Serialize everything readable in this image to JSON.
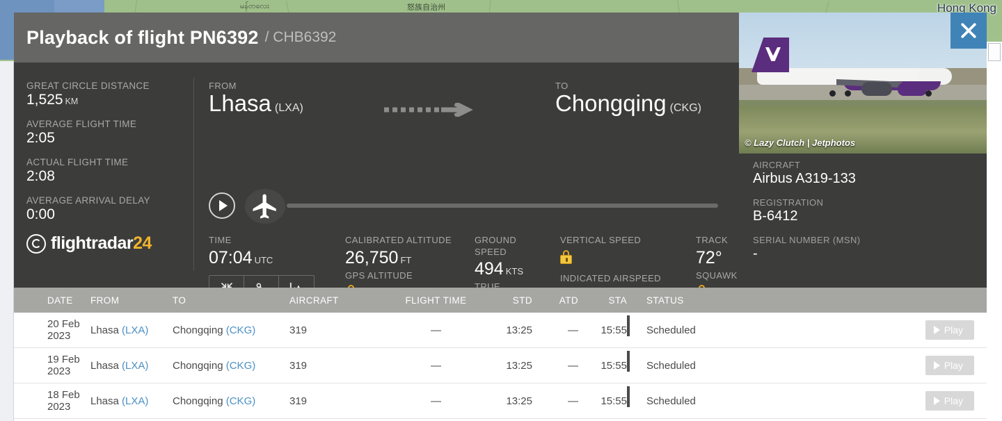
{
  "map": {
    "hong_kong_label": "Hong Kong",
    "labels": [
      "မန်တလေး",
      "怒族自治州"
    ]
  },
  "header": {
    "title": "Playback of flight PN6392",
    "subtitle": "/ CHB6392",
    "close_icon": "close-icon"
  },
  "stats": [
    {
      "label": "GREAT CIRCLE DISTANCE",
      "value": "1,525",
      "unit": "KM"
    },
    {
      "label": "AVERAGE FLIGHT TIME",
      "value": "2:05",
      "unit": ""
    },
    {
      "label": "ACTUAL FLIGHT TIME",
      "value": "2:08",
      "unit": ""
    },
    {
      "label": "AVERAGE ARRIVAL DELAY",
      "value": "0:00",
      "unit": ""
    }
  ],
  "logo": {
    "main": "flightradar",
    "accent": "24",
    "accent_color": "#f0b32d"
  },
  "route": {
    "from_label": "FROM",
    "from_city": "Lhasa",
    "from_code": "(LXA)",
    "to_label": "TO",
    "to_city": "Chongqing",
    "to_code": "(CKG)",
    "arrow_icon": "arrow-right-icon"
  },
  "playback": {
    "play_icon": "play-icon",
    "plane_icon": "airplane-handle-icon",
    "progress_percent": 0
  },
  "telemetry": {
    "time_label": "TIME",
    "time_value": "07:04",
    "time_unit": "UTC",
    "calibrated_altitude_label": "CALIBRATED ALTITUDE",
    "calibrated_altitude_value": "26,750",
    "calibrated_altitude_unit": "FT",
    "gps_altitude_label": "GPS ALTITUDE",
    "ground_speed_label": "GROUND SPEED",
    "ground_speed_value": "494",
    "ground_speed_unit": "KTS",
    "true_airspeed_label": "TRUE AIRSPEED",
    "vertical_speed_label": "VERTICAL SPEED",
    "indicated_airspeed_label": "INDICATED AIRSPEED",
    "track_label": "TRACK",
    "track_value": "72°",
    "squawk_label": "SQUAWK",
    "lock_icon": "lock-icon"
  },
  "icon_buttons": [
    {
      "name": "fit-to-screen-icon"
    },
    {
      "name": "flight-route-icon"
    },
    {
      "name": "altitude-graph-icon"
    }
  ],
  "photo": {
    "credit": "© Lazy Clutch | Jetphotos"
  },
  "aircraft_info": [
    {
      "label": "AIRCRAFT",
      "value": "Airbus A319-133"
    },
    {
      "label": "REGISTRATION",
      "value": "B-6412"
    },
    {
      "label": "SERIAL NUMBER (MSN)",
      "value": "-"
    }
  ],
  "table": {
    "headers": {
      "date": "DATE",
      "from": "FROM",
      "to": "TO",
      "aircraft": "AIRCRAFT",
      "flight_time": "FLIGHT TIME",
      "std": "STD",
      "atd": "ATD",
      "sta": "STA",
      "status": "STATUS"
    },
    "play_label": "Play",
    "rows": [
      {
        "date": "20 Feb 2023",
        "from_city": "Lhasa",
        "from_code": "(LXA)",
        "to_city": "Chongqing",
        "to_code": "(CKG)",
        "aircraft": "319",
        "flight_time": "—",
        "std": "13:25",
        "atd": "—",
        "sta": "15:55",
        "status": "Scheduled"
      },
      {
        "date": "19 Feb 2023",
        "from_city": "Lhasa",
        "from_code": "(LXA)",
        "to_city": "Chongqing",
        "to_code": "(CKG)",
        "aircraft": "319",
        "flight_time": "—",
        "std": "13:25",
        "atd": "—",
        "sta": "15:55",
        "status": "Scheduled"
      },
      {
        "date": "18 Feb 2023",
        "from_city": "Lhasa",
        "from_code": "(LXA)",
        "to_city": "Chongqing",
        "to_code": "(CKG)",
        "aircraft": "319",
        "flight_time": "—",
        "std": "13:25",
        "atd": "—",
        "sta": "15:55",
        "status": "Scheduled"
      }
    ]
  }
}
